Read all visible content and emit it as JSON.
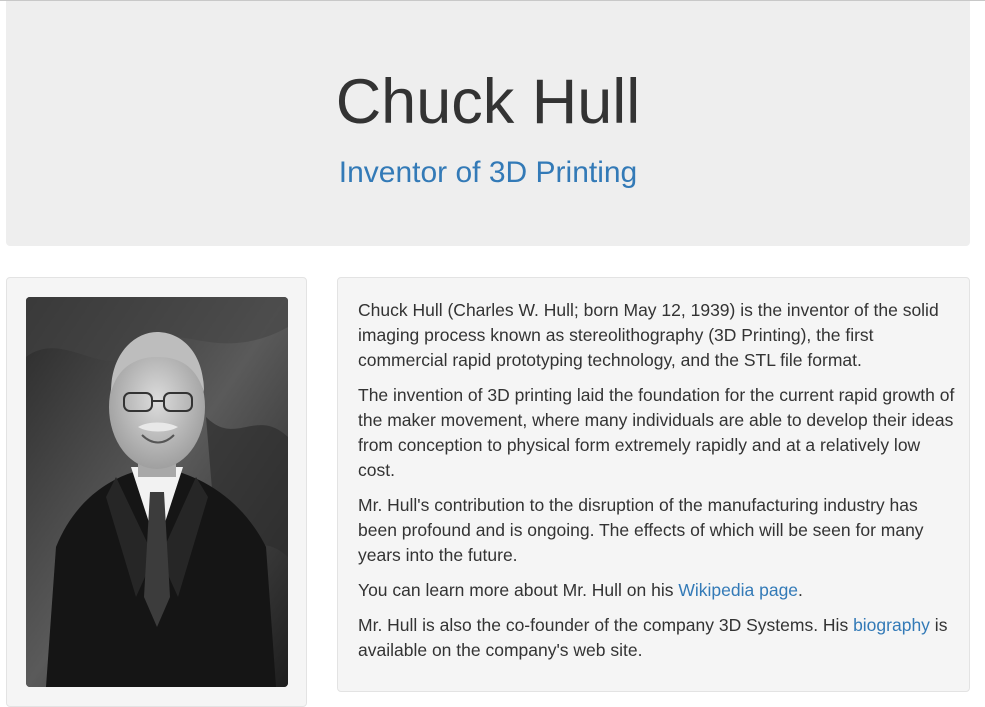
{
  "header": {
    "title": "Chuck Hull",
    "subtitle": "Inventor of 3D Printing"
  },
  "photo": {
    "alt": "Portrait of Chuck Hull"
  },
  "bio": {
    "p1": "Chuck Hull (Charles W. Hull; born May 12, 1939) is the inventor of the solid imaging process known as stereolithography (3D Printing), the first commercial rapid prototyping technology, and the STL file format.",
    "p2": "The invention of 3D printing laid the foundation for the current rapid growth of the maker movement, where many individuals are able to develop their ideas from conception to physical form extremely rapidly and at a relatively low cost.",
    "p3": "Mr. Hull's contribution to the disruption of the manufacturing industry has been profound and is ongoing. The effects of which will be seen for many years into the future.",
    "p4_before": "You can learn more about Mr. Hull on his ",
    "p4_link": "Wikipedia page",
    "p4_after": ".",
    "p5_before": "Mr. Hull is also the co-founder of the company 3D Systems. His ",
    "p5_link": "biography",
    "p5_after": " is available on the company's web site."
  },
  "colors": {
    "link": "#337ab7",
    "jumbotron_bg": "#eeeeee",
    "well_bg": "#f5f5f5"
  }
}
